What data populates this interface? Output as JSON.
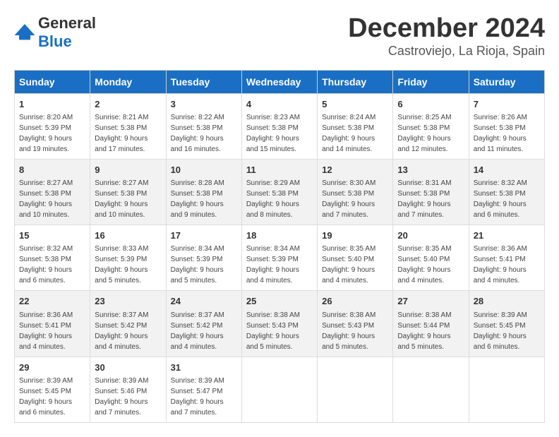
{
  "header": {
    "logo_general": "General",
    "logo_blue": "Blue",
    "month_title": "December 2024",
    "location": "Castroviejo, La Rioja, Spain"
  },
  "days_of_week": [
    "Sunday",
    "Monday",
    "Tuesday",
    "Wednesday",
    "Thursday",
    "Friday",
    "Saturday"
  ],
  "weeks": [
    [
      {
        "day": "1",
        "sunrise": "8:20 AM",
        "sunset": "5:39 PM",
        "daylight": "9 hours and 19 minutes."
      },
      {
        "day": "2",
        "sunrise": "8:21 AM",
        "sunset": "5:38 PM",
        "daylight": "9 hours and 17 minutes."
      },
      {
        "day": "3",
        "sunrise": "8:22 AM",
        "sunset": "5:38 PM",
        "daylight": "9 hours and 16 minutes."
      },
      {
        "day": "4",
        "sunrise": "8:23 AM",
        "sunset": "5:38 PM",
        "daylight": "9 hours and 15 minutes."
      },
      {
        "day": "5",
        "sunrise": "8:24 AM",
        "sunset": "5:38 PM",
        "daylight": "9 hours and 14 minutes."
      },
      {
        "day": "6",
        "sunrise": "8:25 AM",
        "sunset": "5:38 PM",
        "daylight": "9 hours and 12 minutes."
      },
      {
        "day": "7",
        "sunrise": "8:26 AM",
        "sunset": "5:38 PM",
        "daylight": "9 hours and 11 minutes."
      }
    ],
    [
      {
        "day": "8",
        "sunrise": "8:27 AM",
        "sunset": "5:38 PM",
        "daylight": "9 hours and 10 minutes."
      },
      {
        "day": "9",
        "sunrise": "8:27 AM",
        "sunset": "5:38 PM",
        "daylight": "9 hours and 10 minutes."
      },
      {
        "day": "10",
        "sunrise": "8:28 AM",
        "sunset": "5:38 PM",
        "daylight": "9 hours and 9 minutes."
      },
      {
        "day": "11",
        "sunrise": "8:29 AM",
        "sunset": "5:38 PM",
        "daylight": "9 hours and 8 minutes."
      },
      {
        "day": "12",
        "sunrise": "8:30 AM",
        "sunset": "5:38 PM",
        "daylight": "9 hours and 7 minutes."
      },
      {
        "day": "13",
        "sunrise": "8:31 AM",
        "sunset": "5:38 PM",
        "daylight": "9 hours and 7 minutes."
      },
      {
        "day": "14",
        "sunrise": "8:32 AM",
        "sunset": "5:38 PM",
        "daylight": "9 hours and 6 minutes."
      }
    ],
    [
      {
        "day": "15",
        "sunrise": "8:32 AM",
        "sunset": "5:38 PM",
        "daylight": "9 hours and 6 minutes."
      },
      {
        "day": "16",
        "sunrise": "8:33 AM",
        "sunset": "5:39 PM",
        "daylight": "9 hours and 5 minutes."
      },
      {
        "day": "17",
        "sunrise": "8:34 AM",
        "sunset": "5:39 PM",
        "daylight": "9 hours and 5 minutes."
      },
      {
        "day": "18",
        "sunrise": "8:34 AM",
        "sunset": "5:39 PM",
        "daylight": "9 hours and 4 minutes."
      },
      {
        "day": "19",
        "sunrise": "8:35 AM",
        "sunset": "5:40 PM",
        "daylight": "9 hours and 4 minutes."
      },
      {
        "day": "20",
        "sunrise": "8:35 AM",
        "sunset": "5:40 PM",
        "daylight": "9 hours and 4 minutes."
      },
      {
        "day": "21",
        "sunrise": "8:36 AM",
        "sunset": "5:41 PM",
        "daylight": "9 hours and 4 minutes."
      }
    ],
    [
      {
        "day": "22",
        "sunrise": "8:36 AM",
        "sunset": "5:41 PM",
        "daylight": "9 hours and 4 minutes."
      },
      {
        "day": "23",
        "sunrise": "8:37 AM",
        "sunset": "5:42 PM",
        "daylight": "9 hours and 4 minutes."
      },
      {
        "day": "24",
        "sunrise": "8:37 AM",
        "sunset": "5:42 PM",
        "daylight": "9 hours and 4 minutes."
      },
      {
        "day": "25",
        "sunrise": "8:38 AM",
        "sunset": "5:43 PM",
        "daylight": "9 hours and 5 minutes."
      },
      {
        "day": "26",
        "sunrise": "8:38 AM",
        "sunset": "5:43 PM",
        "daylight": "9 hours and 5 minutes."
      },
      {
        "day": "27",
        "sunrise": "8:38 AM",
        "sunset": "5:44 PM",
        "daylight": "9 hours and 5 minutes."
      },
      {
        "day": "28",
        "sunrise": "8:39 AM",
        "sunset": "5:45 PM",
        "daylight": "9 hours and 6 minutes."
      }
    ],
    [
      {
        "day": "29",
        "sunrise": "8:39 AM",
        "sunset": "5:45 PM",
        "daylight": "9 hours and 6 minutes."
      },
      {
        "day": "30",
        "sunrise": "8:39 AM",
        "sunset": "5:46 PM",
        "daylight": "9 hours and 7 minutes."
      },
      {
        "day": "31",
        "sunrise": "8:39 AM",
        "sunset": "5:47 PM",
        "daylight": "9 hours and 7 minutes."
      },
      null,
      null,
      null,
      null
    ]
  ],
  "labels": {
    "sunrise": "Sunrise:",
    "sunset": "Sunset:",
    "daylight": "Daylight:"
  }
}
